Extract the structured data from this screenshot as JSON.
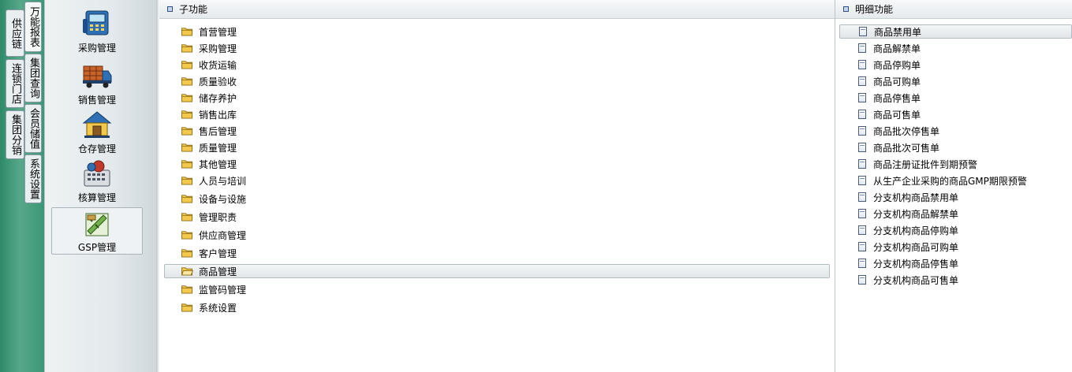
{
  "vertical_tabs": [
    {
      "label": "万能报表"
    },
    {
      "label": "供应链"
    },
    {
      "label": "集团查询"
    },
    {
      "label": "连锁门店"
    },
    {
      "label": "会员储值"
    },
    {
      "label": "集团分销"
    },
    {
      "label": "系统设置"
    }
  ],
  "modules": [
    {
      "label": "采购管理",
      "icon": "purchase-icon"
    },
    {
      "label": "销售管理",
      "icon": "truck-icon"
    },
    {
      "label": "仓存管理",
      "icon": "warehouse-icon"
    },
    {
      "label": "核算管理",
      "icon": "calculator-icon"
    },
    {
      "label": "GSP管理",
      "icon": "gsp-icon",
      "selected": true
    }
  ],
  "sub_panel": {
    "title": "子功能",
    "items": [
      {
        "label": "首营管理"
      },
      {
        "label": "采购管理"
      },
      {
        "label": "收货运输"
      },
      {
        "label": "质量验收"
      },
      {
        "label": "储存养护"
      },
      {
        "label": "销售出库"
      },
      {
        "label": "售后管理"
      },
      {
        "label": "质量管理"
      },
      {
        "label": "其他管理"
      },
      {
        "label": "人员与培训"
      },
      {
        "label": "设备与设施"
      },
      {
        "label": "管理职责"
      },
      {
        "label": "供应商管理"
      },
      {
        "label": "客户管理"
      },
      {
        "label": "商品管理",
        "selected": true
      },
      {
        "label": "监管码管理"
      },
      {
        "label": "系统设置"
      }
    ]
  },
  "detail_panel": {
    "title": "明细功能",
    "items": [
      {
        "label": "商品禁用单",
        "selected": true
      },
      {
        "label": "商品解禁单"
      },
      {
        "label": "商品停购单"
      },
      {
        "label": "商品可购单"
      },
      {
        "label": "商品停售单"
      },
      {
        "label": "商品可售单"
      },
      {
        "label": "商品批次停售单"
      },
      {
        "label": "商品批次可售单"
      },
      {
        "label": "商品注册证批件到期预警"
      },
      {
        "label": "从生产企业采购的商品GMP期限预警"
      },
      {
        "label": "分支机构商品禁用单"
      },
      {
        "label": "分支机构商品解禁单"
      },
      {
        "label": "分支机构商品停购单"
      },
      {
        "label": "分支机构商品可购单"
      },
      {
        "label": "分支机构商品停售单"
      },
      {
        "label": "分支机构商品可售单"
      }
    ]
  },
  "colors": {
    "strip_green": "#3c9777",
    "folder_yellow": "#f2c94c",
    "bullet_blue": "#2a4f8a"
  }
}
